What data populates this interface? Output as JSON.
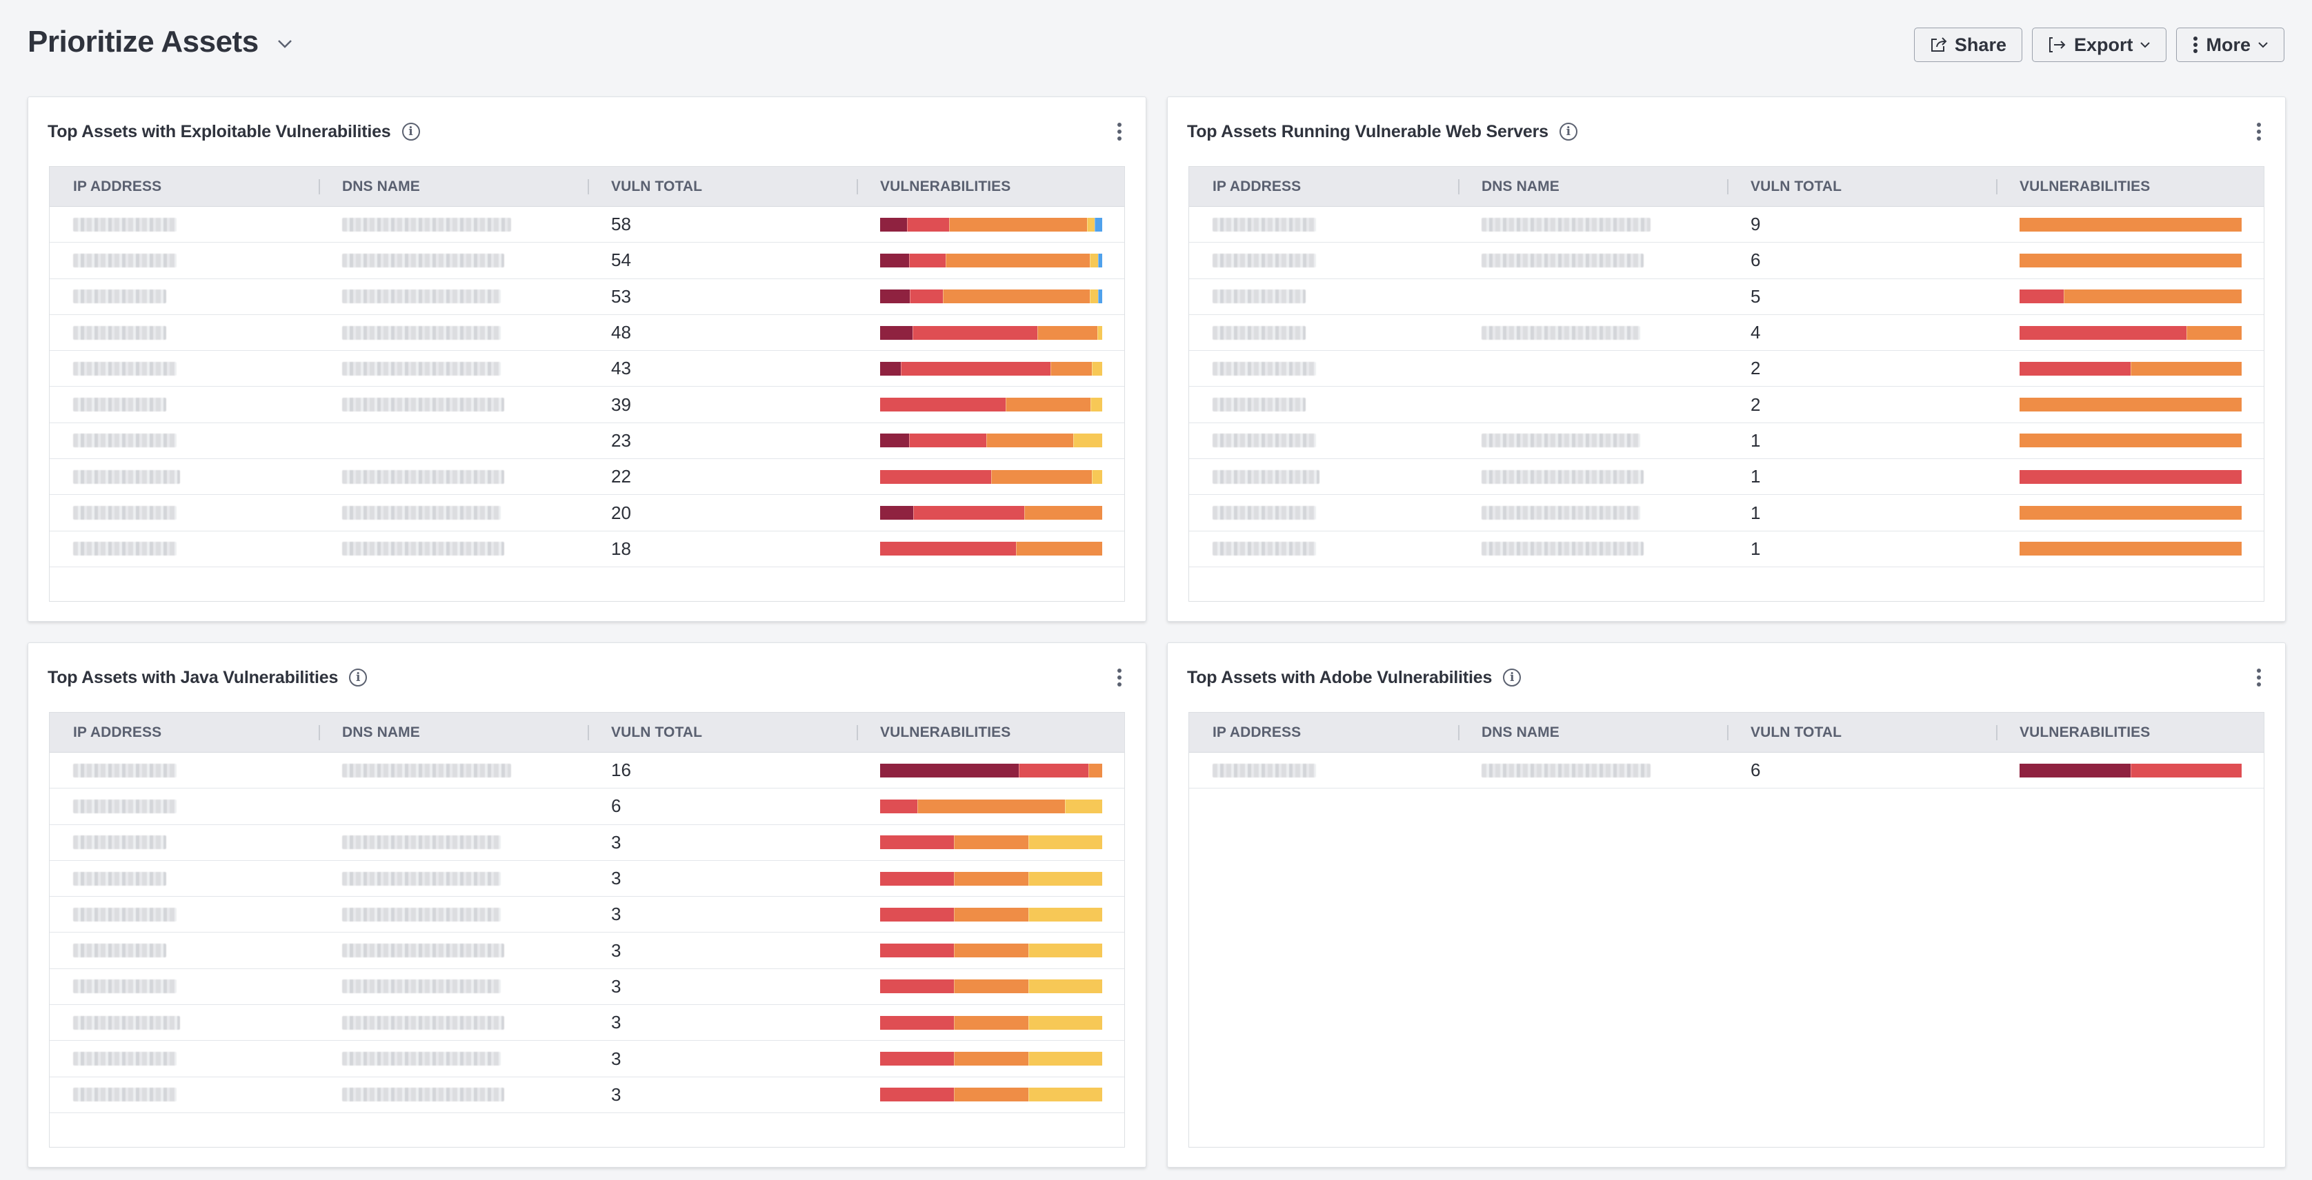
{
  "header": {
    "title": "Prioritize Assets",
    "actions": {
      "share": "Share",
      "export": "Export",
      "more": "More"
    }
  },
  "severity_colors": {
    "critical": "#8f2240",
    "high": "#df4e53",
    "medium": "#ef8d46",
    "low": "#f7c856",
    "info": "#4fa1ec"
  },
  "columns": [
    "IP ADDRESS",
    "DNS NAME",
    "VULN TOTAL",
    "VULNERABILITIES"
  ],
  "panels": [
    {
      "title": "Top Assets with Exploitable Vulnerabilities",
      "rows": [
        {
          "ip_redacted": true,
          "dns_redacted": true,
          "total": "58",
          "seg": [
            7,
            11,
            36,
            2,
            2
          ]
        },
        {
          "ip_redacted": true,
          "dns_redacted": true,
          "total": "54",
          "seg": [
            7,
            9,
            35,
            2,
            1
          ]
        },
        {
          "ip_redacted": true,
          "dns_redacted": true,
          "total": "53",
          "seg": [
            7,
            8,
            35,
            2,
            1
          ]
        },
        {
          "ip_redacted": true,
          "dns_redacted": true,
          "total": "48",
          "seg": [
            7,
            27,
            13,
            1,
            0
          ]
        },
        {
          "ip_redacted": true,
          "dns_redacted": true,
          "total": "43",
          "seg": [
            4,
            29,
            8,
            2,
            0
          ]
        },
        {
          "ip_redacted": true,
          "dns_redacted": true,
          "total": "39",
          "seg": [
            0,
            22,
            15,
            2,
            0
          ]
        },
        {
          "ip_redacted": true,
          "dns_redacted": false,
          "total": "23",
          "seg": [
            3,
            8,
            9,
            3,
            0
          ]
        },
        {
          "ip_redacted": true,
          "dns_redacted": true,
          "total": "22",
          "seg": [
            0,
            11,
            10,
            1,
            0
          ]
        },
        {
          "ip_redacted": true,
          "dns_redacted": true,
          "total": "20",
          "seg": [
            3,
            10,
            7,
            0,
            0
          ]
        },
        {
          "ip_redacted": true,
          "dns_redacted": true,
          "total": "18",
          "seg": [
            0,
            11,
            7,
            0,
            0
          ]
        }
      ]
    },
    {
      "title": "Top Assets Running Vulnerable Web Servers",
      "rows": [
        {
          "ip_redacted": true,
          "dns_redacted": true,
          "total": "9",
          "seg": [
            0,
            0,
            9,
            0,
            0
          ]
        },
        {
          "ip_redacted": true,
          "dns_redacted": true,
          "total": "6",
          "seg": [
            0,
            0,
            6,
            0,
            0
          ]
        },
        {
          "ip_redacted": true,
          "dns_redacted": false,
          "total": "5",
          "seg": [
            0,
            1,
            4,
            0,
            0
          ]
        },
        {
          "ip_redacted": true,
          "dns_redacted": true,
          "total": "4",
          "seg": [
            0,
            3,
            1,
            0,
            0
          ]
        },
        {
          "ip_redacted": true,
          "dns_redacted": false,
          "total": "2",
          "seg": [
            0,
            1,
            1,
            0,
            0
          ]
        },
        {
          "ip_redacted": true,
          "dns_redacted": false,
          "total": "2",
          "seg": [
            0,
            0,
            2,
            0,
            0
          ]
        },
        {
          "ip_redacted": true,
          "dns_redacted": true,
          "total": "1",
          "seg": [
            0,
            0,
            1,
            0,
            0
          ]
        },
        {
          "ip_redacted": true,
          "dns_redacted": true,
          "total": "1",
          "seg": [
            0,
            1,
            0,
            0,
            0
          ]
        },
        {
          "ip_redacted": true,
          "dns_redacted": true,
          "total": "1",
          "seg": [
            0,
            0,
            1,
            0,
            0
          ]
        },
        {
          "ip_redacted": true,
          "dns_redacted": true,
          "total": "1",
          "seg": [
            0,
            0,
            1,
            0,
            0
          ]
        }
      ]
    },
    {
      "title": "Top Assets with Java Vulnerabilities",
      "rows": [
        {
          "ip_redacted": true,
          "dns_redacted": true,
          "total": "16",
          "seg": [
            10,
            5,
            1,
            0,
            0
          ]
        },
        {
          "ip_redacted": true,
          "dns_redacted": false,
          "total": "6",
          "seg": [
            0,
            1,
            4,
            1,
            0
          ]
        },
        {
          "ip_redacted": true,
          "dns_redacted": true,
          "total": "3",
          "seg": [
            0,
            1,
            1,
            1,
            0
          ]
        },
        {
          "ip_redacted": true,
          "dns_redacted": true,
          "total": "3",
          "seg": [
            0,
            1,
            1,
            1,
            0
          ]
        },
        {
          "ip_redacted": true,
          "dns_redacted": true,
          "total": "3",
          "seg": [
            0,
            1,
            1,
            1,
            0
          ]
        },
        {
          "ip_redacted": true,
          "dns_redacted": true,
          "total": "3",
          "seg": [
            0,
            1,
            1,
            1,
            0
          ]
        },
        {
          "ip_redacted": true,
          "dns_redacted": true,
          "total": "3",
          "seg": [
            0,
            1,
            1,
            1,
            0
          ]
        },
        {
          "ip_redacted": true,
          "dns_redacted": true,
          "total": "3",
          "seg": [
            0,
            1,
            1,
            1,
            0
          ]
        },
        {
          "ip_redacted": true,
          "dns_redacted": true,
          "total": "3",
          "seg": [
            0,
            1,
            1,
            1,
            0
          ]
        },
        {
          "ip_redacted": true,
          "dns_redacted": true,
          "total": "3",
          "seg": [
            0,
            1,
            1,
            1,
            0
          ]
        }
      ]
    },
    {
      "title": "Top Assets with Adobe Vulnerabilities",
      "rows": [
        {
          "ip_redacted": true,
          "dns_redacted": true,
          "total": "6",
          "seg": [
            3,
            3,
            0,
            0,
            0
          ]
        }
      ]
    }
  ]
}
